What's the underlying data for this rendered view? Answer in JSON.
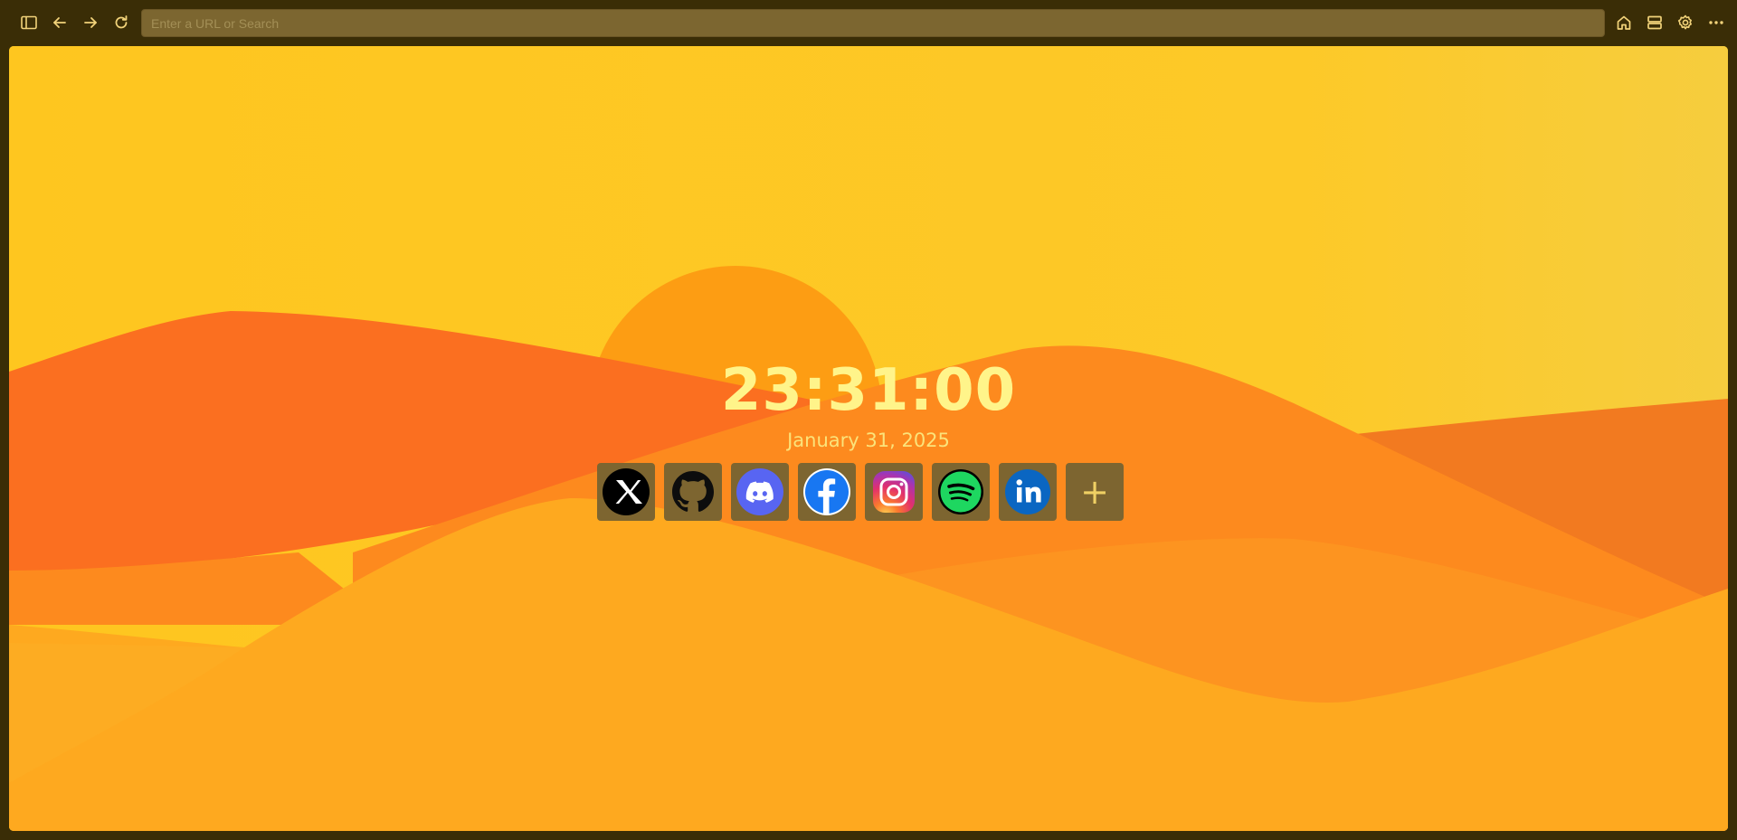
{
  "toolbar": {
    "url_placeholder": "Enter a URL or Search",
    "url_value": "",
    "icons": [
      "sidebar-toggle-icon",
      "back-arrow-icon",
      "forward-arrow-icon",
      "reload-icon",
      "home-icon",
      "tabs-icon",
      "gear-icon",
      "more-icon"
    ]
  },
  "newtab": {
    "time": "23:31:00",
    "date": "January 31, 2025",
    "shortcuts": [
      {
        "name": "X",
        "icon": "x-icon"
      },
      {
        "name": "GitHub",
        "icon": "github-icon"
      },
      {
        "name": "Discord",
        "icon": "discord-icon"
      },
      {
        "name": "Facebook",
        "icon": "facebook-icon"
      },
      {
        "name": "Instagram",
        "icon": "instagram-icon"
      },
      {
        "name": "Spotify",
        "icon": "spotify-icon"
      },
      {
        "name": "LinkedIn",
        "icon": "linkedin-icon"
      }
    ],
    "add_label": "+"
  },
  "colors": {
    "frame": "#3a2d06",
    "url_bar": "#7c6630",
    "sky": "#fdc724",
    "clock": "#fff48a",
    "shortcut_tile": "#7d6530"
  }
}
